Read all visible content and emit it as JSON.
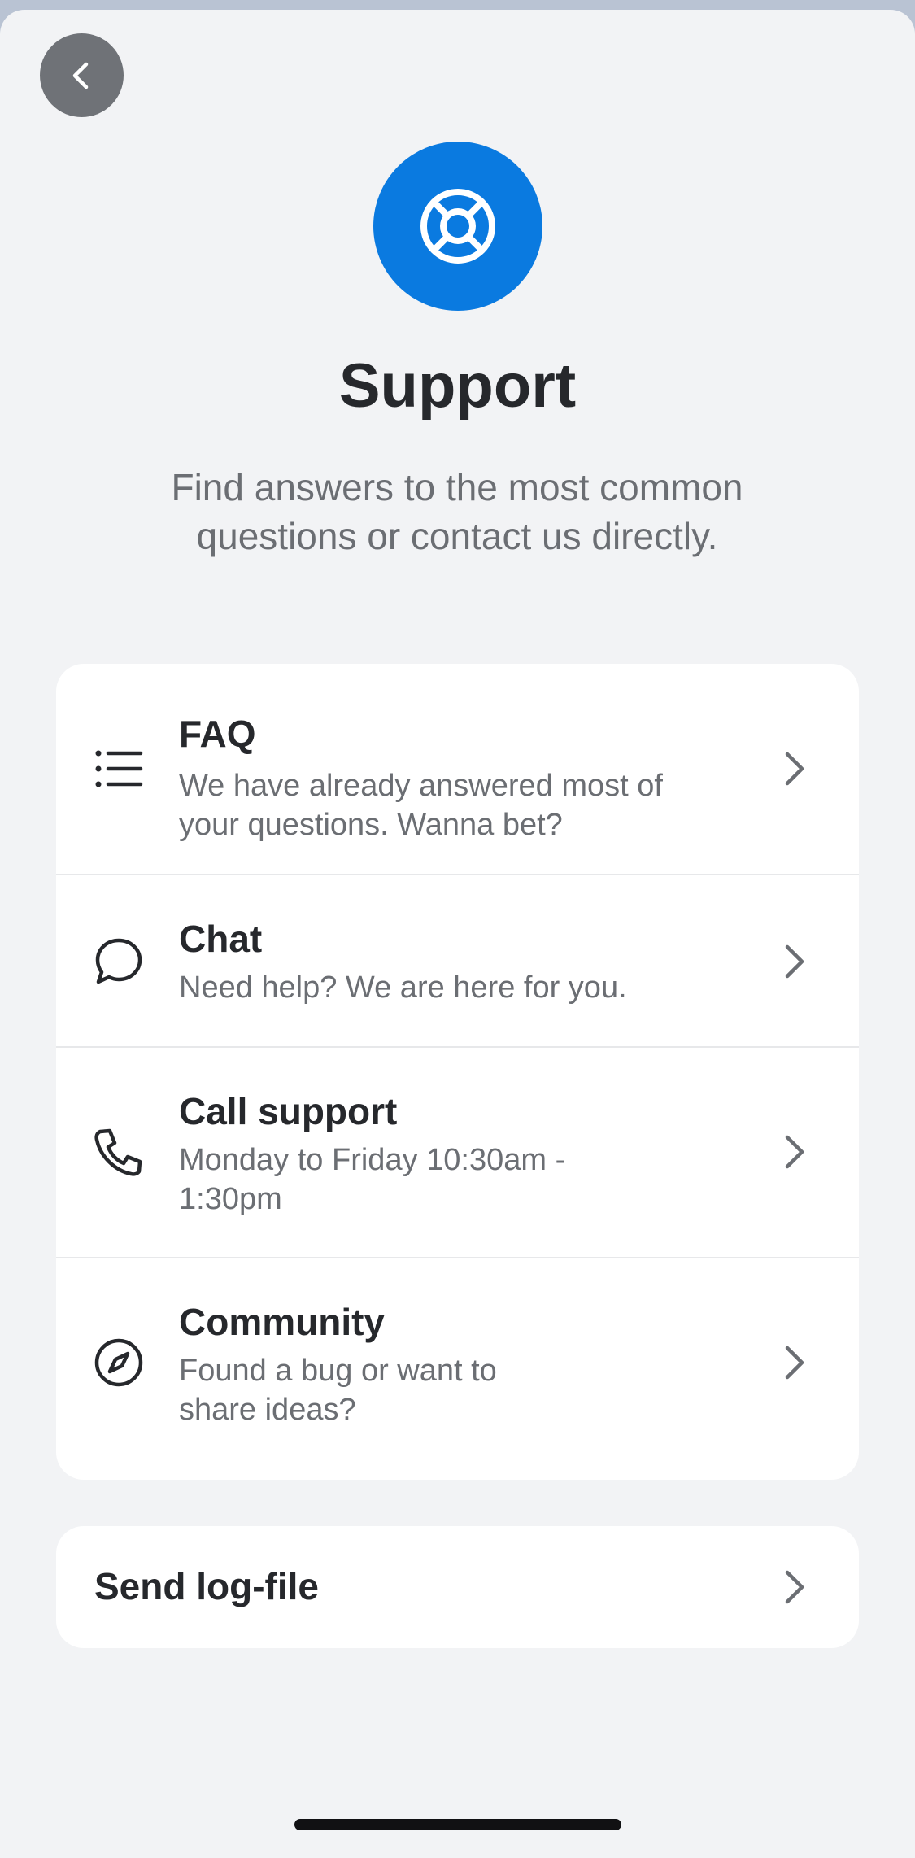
{
  "header": {
    "back_icon": "chevron-left-icon",
    "hero_icon": "lifebuoy-icon",
    "hero_color": "#0a7ae0",
    "title": "Support",
    "subtitle_line1": "Find answers to the most common",
    "subtitle_line2": "questions or contact us directly."
  },
  "options": [
    {
      "icon": "list-icon",
      "title": "FAQ",
      "desc_line1": "We have already answered most of",
      "desc_line2": "your questions. Wanna bet?"
    },
    {
      "icon": "chat-bubble-icon",
      "title": "Chat",
      "desc_line1": "Need help? We are here for you."
    },
    {
      "icon": "phone-icon",
      "title": "Call support",
      "desc_line1": "Monday to Friday 10:30am -",
      "desc_line2": "1:30pm"
    },
    {
      "icon": "compass-icon",
      "title": "Community",
      "desc_line1": "Found a bug or want to",
      "desc_line2": "share ideas?"
    }
  ],
  "log": {
    "label": "Send log-file"
  }
}
